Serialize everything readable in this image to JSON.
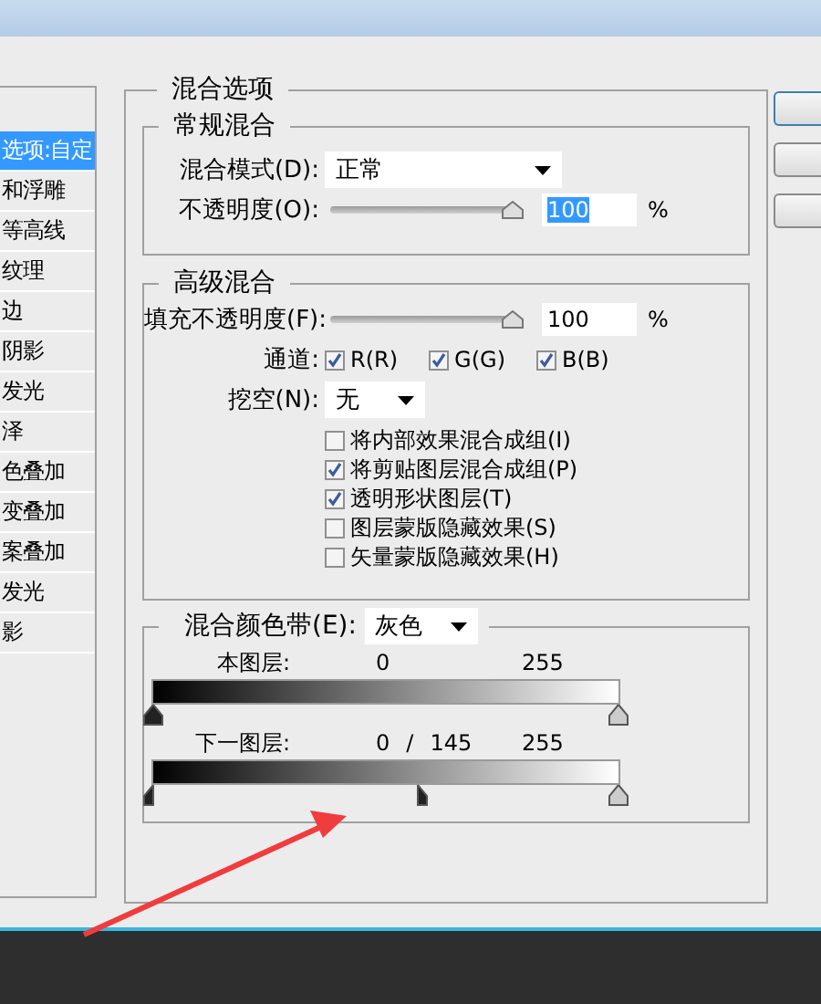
{
  "style_list": [
    {
      "label": "选项:自定",
      "selected": true
    },
    {
      "label": "和浮雕",
      "selected": false
    },
    {
      "label": "等高线",
      "selected": false
    },
    {
      "label": "纹理",
      "selected": false
    },
    {
      "label": "边",
      "selected": false
    },
    {
      "label": "阴影",
      "selected": false
    },
    {
      "label": "发光",
      "selected": false
    },
    {
      "label": "泽",
      "selected": false
    },
    {
      "label": "色叠加",
      "selected": false
    },
    {
      "label": "变叠加",
      "selected": false
    },
    {
      "label": "案叠加",
      "selected": false
    },
    {
      "label": "发光",
      "selected": false
    },
    {
      "label": "影",
      "selected": false
    }
  ],
  "blending_options": {
    "title": "混合选项",
    "general": {
      "title": "常规混合",
      "blend_mode": {
        "label": "混合模式(D):",
        "value": "正常"
      },
      "opacity": {
        "label": "不透明度(O):",
        "level": 1,
        "value": "100",
        "highlighted": true,
        "unit": "%"
      }
    },
    "advanced": {
      "title": "高级混合",
      "fill_opacity": {
        "label": "填充不透明度(F):",
        "level": 1,
        "value": "100",
        "highlighted": false,
        "unit": "%"
      },
      "channels_label": "通道:",
      "channels": [
        {
          "label": "R(R)",
          "checked": true
        },
        {
          "label": "G(G)",
          "checked": true
        },
        {
          "label": "B(B)",
          "checked": true
        }
      ],
      "knockout": {
        "label": "挖空(N):",
        "value": "无"
      },
      "options": [
        {
          "label": "将内部效果混合成组(I)",
          "checked": false
        },
        {
          "label": "将剪贴图层混合成组(P)",
          "checked": true
        },
        {
          "label": "透明形状图层(T)",
          "checked": true
        },
        {
          "label": "图层蒙版隐藏效果(S)",
          "checked": false
        },
        {
          "label": "矢量蒙版隐藏效果(H)",
          "checked": false
        }
      ]
    },
    "blend_if": {
      "label": "混合颜色带(E):",
      "value": "灰色",
      "bands": [
        {
          "label": "本图层:",
          "readings": [
            "0",
            "255"
          ],
          "thumbs": [
            {
              "kind": "black",
              "level": 0
            },
            {
              "kind": "white",
              "level": 1
            }
          ]
        },
        {
          "label": "下一图层:",
          "readings": [
            "0",
            "/",
            "145",
            "255"
          ],
          "thumbs": [
            {
              "kind": "black-left",
              "level": 0
            },
            {
              "kind": "black-right",
              "level": 0.569
            },
            {
              "kind": "white",
              "level": 1
            }
          ]
        }
      ]
    }
  },
  "dialog_buttons": [
    {
      "default": true
    },
    {
      "default": false
    },
    {
      "default": false
    }
  ]
}
